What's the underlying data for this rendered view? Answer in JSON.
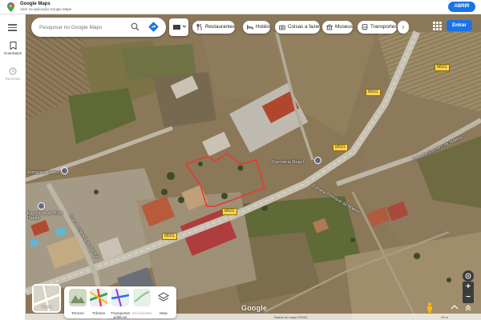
{
  "banner": {
    "title": "Google Maps",
    "subtitle": "Abrir na aplicação Google Maps",
    "open_label": "ABRIR"
  },
  "rail": {
    "saved_label": "Guardados",
    "recent_label": "Recentes"
  },
  "search": {
    "placeholder": "Pesquisar no Google Maps"
  },
  "chips": [
    {
      "label": "Restaurantes",
      "icon": "restaurant-icon"
    },
    {
      "label": "Hotéis",
      "icon": "hotel-icon"
    },
    {
      "label": "Coisas a fazer",
      "icon": "camera-icon"
    },
    {
      "label": "Museus",
      "icon": "museum-icon"
    },
    {
      "label": "Transportes",
      "icon": "transit-icon"
    }
  ],
  "signin_label": "Entrar",
  "map": {
    "place_labels": [
      "Armazém Ceipo",
      "Escolinha do Bom Pastor",
      "Farmácia Regol"
    ],
    "street_labels": [
      "Estrada Cruzeiro da Mãeira",
      "Estrada Principal da Mãeira",
      "Rua da Estrada do Apreço"
    ],
    "road_shields": [
      "M501",
      "M501",
      "M501",
      "M501",
      "M501"
    ]
  },
  "layers": {
    "current_label": "Mapa",
    "options": [
      {
        "label": "Terreno",
        "icon": "terrain-icon"
      },
      {
        "label": "Trânsito",
        "icon": "traffic-icon"
      },
      {
        "label": "Transportes públicos",
        "icon": "transit-layer-icon"
      },
      {
        "label": "De bicicleta",
        "icon": "bike-icon",
        "dim": true
      },
      {
        "label": "Mais",
        "icon": "layers-icon"
      }
    ]
  },
  "footer": {
    "logo": "Google",
    "copyright": "Dados do mapa ©2024",
    "scale": "10 m"
  },
  "colors": {
    "accent": "#1a73e8",
    "boundary": "#e53935",
    "road_shield": "#fcd34d"
  }
}
